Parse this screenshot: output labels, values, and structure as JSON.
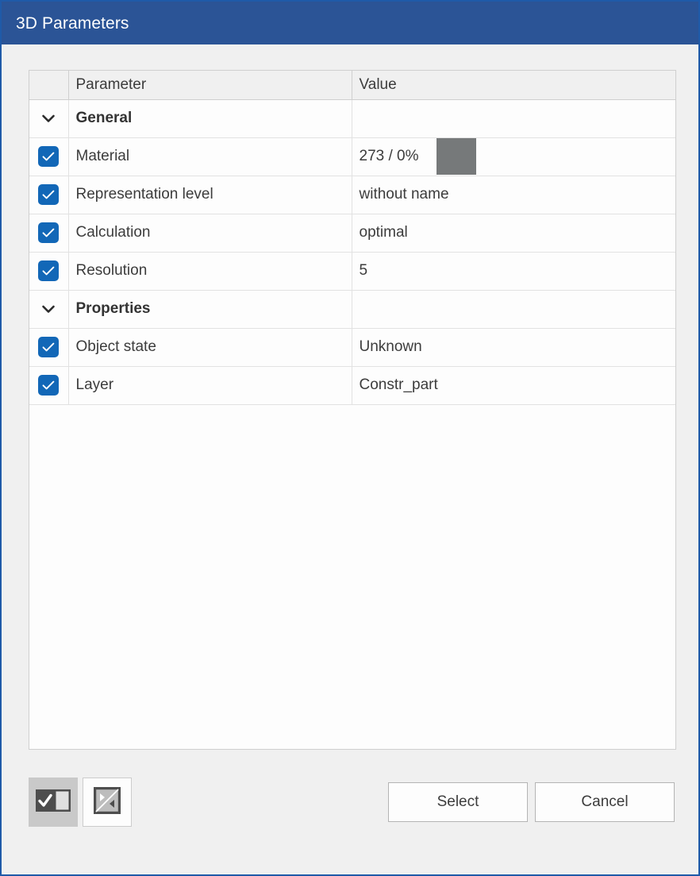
{
  "window": {
    "title": "3D Parameters",
    "title_bar_color": "#2b5496",
    "border_color": "#1f5aa8",
    "body_color": "#f0f0f0"
  },
  "table": {
    "headers": {
      "check": "",
      "parameter": "Parameter",
      "value": "Value"
    },
    "rows": [
      {
        "type": "group",
        "icon": "chevron-down-icon",
        "checked": null,
        "parameter": "General",
        "value": ""
      },
      {
        "type": "param",
        "icon": "checkbox-checked-icon",
        "checked": true,
        "parameter": "Material",
        "value": "273 / 0%",
        "swatch": "#76797a"
      },
      {
        "type": "param",
        "icon": "checkbox-checked-icon",
        "checked": true,
        "parameter": "Representation level",
        "value": "without name"
      },
      {
        "type": "param",
        "icon": "checkbox-checked-icon",
        "checked": true,
        "parameter": "Calculation",
        "value": "optimal"
      },
      {
        "type": "param",
        "icon": "checkbox-checked-icon",
        "checked": true,
        "parameter": "Resolution",
        "value": "5"
      },
      {
        "type": "group",
        "icon": "chevron-down-icon",
        "checked": null,
        "parameter": "Properties",
        "value": ""
      },
      {
        "type": "param",
        "icon": "checkbox-checked-icon",
        "checked": true,
        "parameter": "Object state",
        "value": "Unknown"
      },
      {
        "type": "param",
        "icon": "checkbox-checked-icon",
        "checked": true,
        "parameter": "Layer",
        "value": "Constr_part"
      }
    ]
  },
  "footer": {
    "tools": [
      {
        "name": "select-all-toggle-button",
        "icon": "checkbox-toggle-icon",
        "state": "pressed",
        "label": ""
      },
      {
        "name": "invert-selection-button",
        "icon": "invert-selection-icon",
        "state": "normal",
        "label": ""
      }
    ],
    "select_label": "Select",
    "cancel_label": "Cancel"
  },
  "colors": {
    "checkbox_blue": "#1267b7",
    "material_swatch": "#76797a",
    "header_bg": "#f0f0f0",
    "grid_line": "#e2e2e2"
  }
}
